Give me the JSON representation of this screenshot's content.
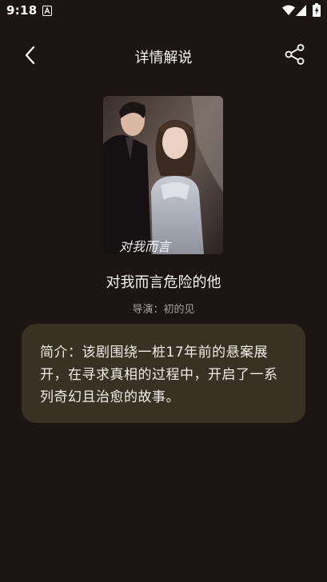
{
  "status_bar": {
    "time": "9:18"
  },
  "header": {
    "title": "详情解说"
  },
  "drama": {
    "title": "对我而言危险的他",
    "director": "导演：初的见",
    "poster_overlay_text": "对我而言"
  },
  "synopsis": {
    "text": "简介：该剧围绕一桩17年前的悬案展开，在寻求真相的过程中，开启了一系列奇幻且治愈的故事。"
  },
  "colors": {
    "background": "#1b1614",
    "card": "#3a3125",
    "muted_text": "#a8a29e"
  }
}
